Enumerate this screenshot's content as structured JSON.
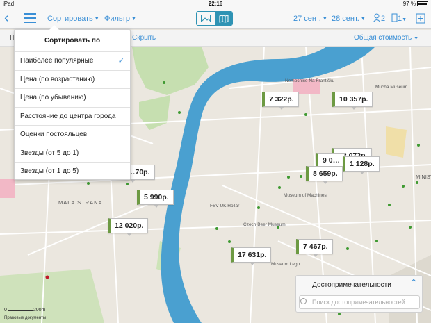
{
  "status": {
    "device": "iPad",
    "time": "22:16",
    "battery": "97 %"
  },
  "nav": {
    "sort_label": "Сортировать",
    "filter_label": "Фильтр",
    "checkin": "27 сент.",
    "checkout": "28 сент.",
    "guests": "2",
    "rooms": "1"
  },
  "subbar": {
    "hide_link": "Скрыть",
    "total_cost": "Общая стоимость",
    "p_label": "П"
  },
  "sort_menu": {
    "title": "Сортировать по",
    "items": [
      "Наиболее популярные",
      "Цена (по возрастанию)",
      "Цена (по убыванию)",
      "Расстояние до центра города",
      "Оценки постояльцев",
      "Звезды (от 5 до 1)",
      "Звезды (от 1 до 5)"
    ],
    "selected_index": 0
  },
  "prices": [
    {
      "label": "7 322р."
    },
    {
      "label": "10 357р."
    },
    {
      "label": "12 072р."
    },
    {
      "label": "9 0…"
    },
    {
      "label": "1 128р."
    },
    {
      "label": "8 659р."
    },
    {
      "label": "…70р."
    },
    {
      "label": "5 990р."
    },
    {
      "label": "12 020р."
    },
    {
      "label": "7 467р."
    },
    {
      "label": "17 631р."
    }
  ],
  "map_labels": {
    "mala_strana": "MALA STRANA",
    "minis": "MINISТ",
    "hollar": "FSV UK Hollar",
    "mucha": "Mucha Museum",
    "beer": "Czech Beer Museum",
    "lego": "Museum Lego",
    "machines": "Museum of Machines",
    "hospital": "Nemocnice Na Františku"
  },
  "landmarks": {
    "title": "Достопримечательности",
    "search_placeholder": "Поиск достопримечательностей"
  },
  "scale": "200m",
  "legal": "Правовые документы",
  "colors": {
    "accent": "#3a8fd6",
    "river": "#4aa0d0",
    "park": "#b5d79b",
    "marker_border": "#6d9a43"
  }
}
